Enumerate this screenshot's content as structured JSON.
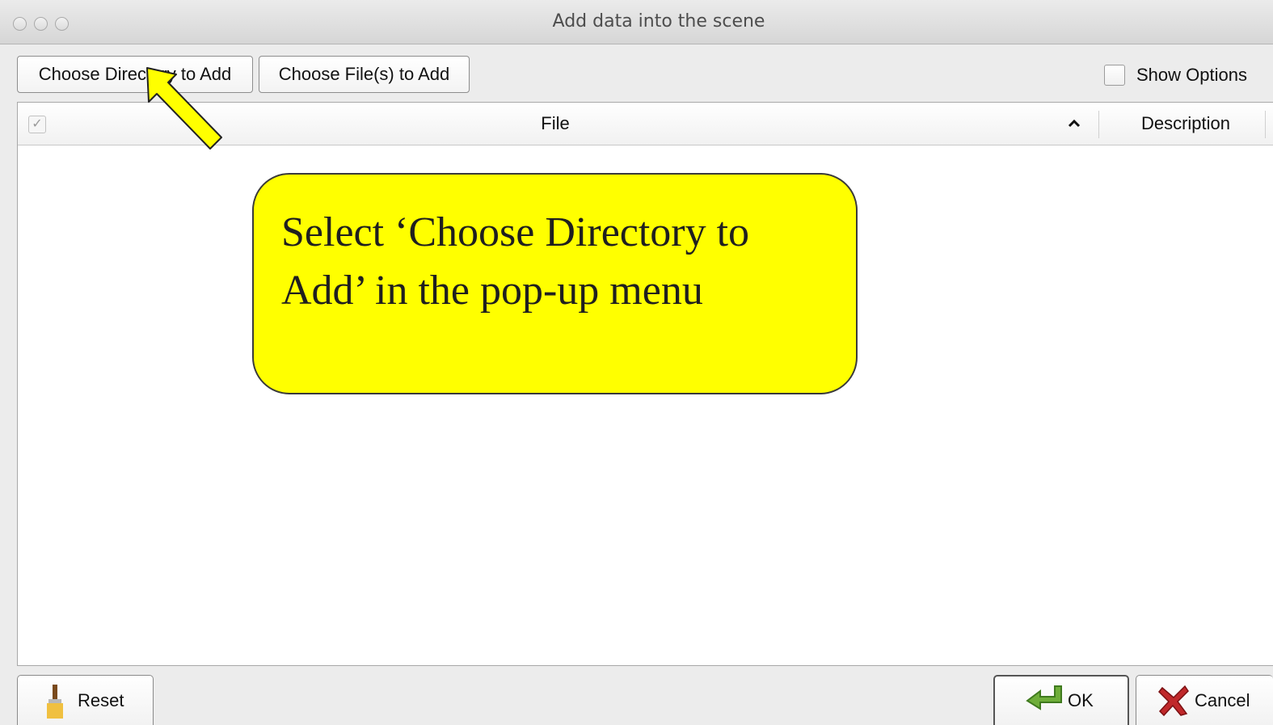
{
  "window": {
    "title": "Add data into the scene"
  },
  "toolbar": {
    "choose_directory_label": "Choose Directory to Add",
    "choose_files_label": "Choose File(s) to Add",
    "show_options_label": "Show Options",
    "show_options_checked": false
  },
  "table": {
    "columns": [
      {
        "label": "File",
        "sort": "ascending"
      },
      {
        "label": "Description"
      }
    ],
    "rows": []
  },
  "footer": {
    "reset_label": "Reset",
    "ok_label": "OK",
    "cancel_label": "Cancel"
  },
  "annotation": {
    "text": "Select ‘Choose Directory to Add’ in the pop-up menu",
    "color": "#ffff00"
  },
  "icons": {
    "sort": "chevron-up-icon",
    "reset": "paint-brush-icon",
    "ok": "green-return-arrow-icon",
    "cancel": "red-x-icon",
    "pointer": "yellow-arrow-icon"
  }
}
